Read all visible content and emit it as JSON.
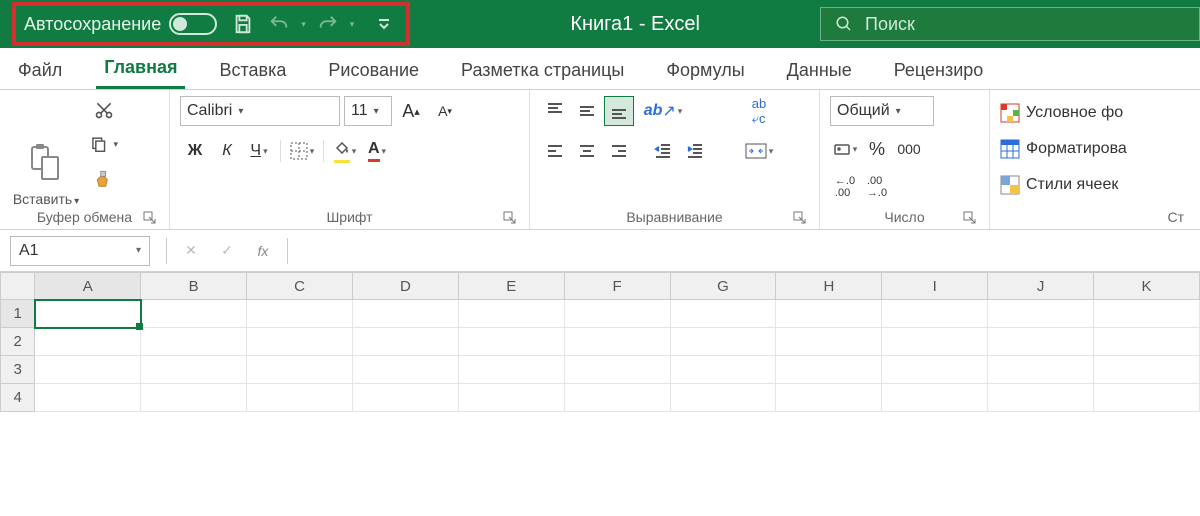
{
  "titlebar": {
    "autosave_label": "Автосохранение",
    "title": "Книга1  -  Excel",
    "search_placeholder": "Поиск"
  },
  "tabs": [
    "Файл",
    "Главная",
    "Вставка",
    "Рисование",
    "Разметка страницы",
    "Формулы",
    "Данные",
    "Рецензиро"
  ],
  "active_tab_index": 1,
  "ribbon": {
    "clipboard": {
      "paste": "Вставить",
      "label": "Буфер обмена"
    },
    "font": {
      "name": "Calibri",
      "size": "11",
      "bold": "Ж",
      "italic": "К",
      "underline": "Ч",
      "label": "Шрифт"
    },
    "alignment": {
      "label": "Выравнивание"
    },
    "number": {
      "format": "Общий",
      "label": "Число"
    },
    "styles": {
      "cond": "Условное фо",
      "table": "Форматирова",
      "cell": "Стили ячеек",
      "label": "Ст"
    }
  },
  "formula_bar": {
    "name_box": "A1",
    "fx": "fx"
  },
  "grid": {
    "columns": [
      "A",
      "B",
      "C",
      "D",
      "E",
      "F",
      "G",
      "H",
      "I",
      "J",
      "K"
    ],
    "rows": [
      "1",
      "2",
      "3",
      "4"
    ],
    "selected_cell": "A1"
  }
}
